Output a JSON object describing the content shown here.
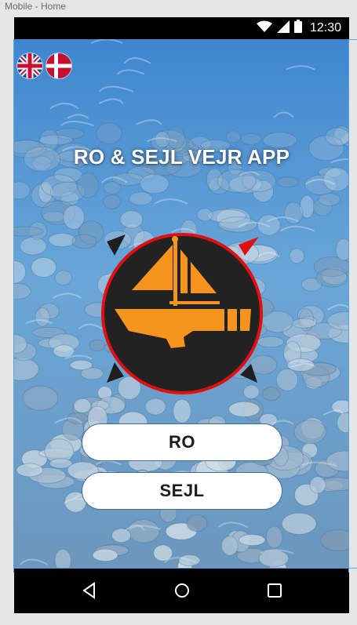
{
  "frame": {
    "label": "Mobile - Home"
  },
  "statusbar": {
    "time": "12:30",
    "icons": [
      "wifi-icon",
      "signal-icon",
      "battery-icon"
    ]
  },
  "language": {
    "options": [
      {
        "code": "en",
        "name": "uk-flag-icon"
      },
      {
        "code": "da",
        "name": "denmark-flag-icon"
      }
    ]
  },
  "app": {
    "title": "RO & SEJL VEJR APP"
  },
  "logo": {
    "name": "sailboat-logo",
    "colors": {
      "orange": "#f7941d",
      "dark": "#222222",
      "ring": "#e01010"
    }
  },
  "buttons": {
    "ro": "RO",
    "sejl": "SEJL"
  },
  "navbar": {
    "items": [
      "back-icon",
      "home-icon",
      "recents-icon"
    ]
  }
}
